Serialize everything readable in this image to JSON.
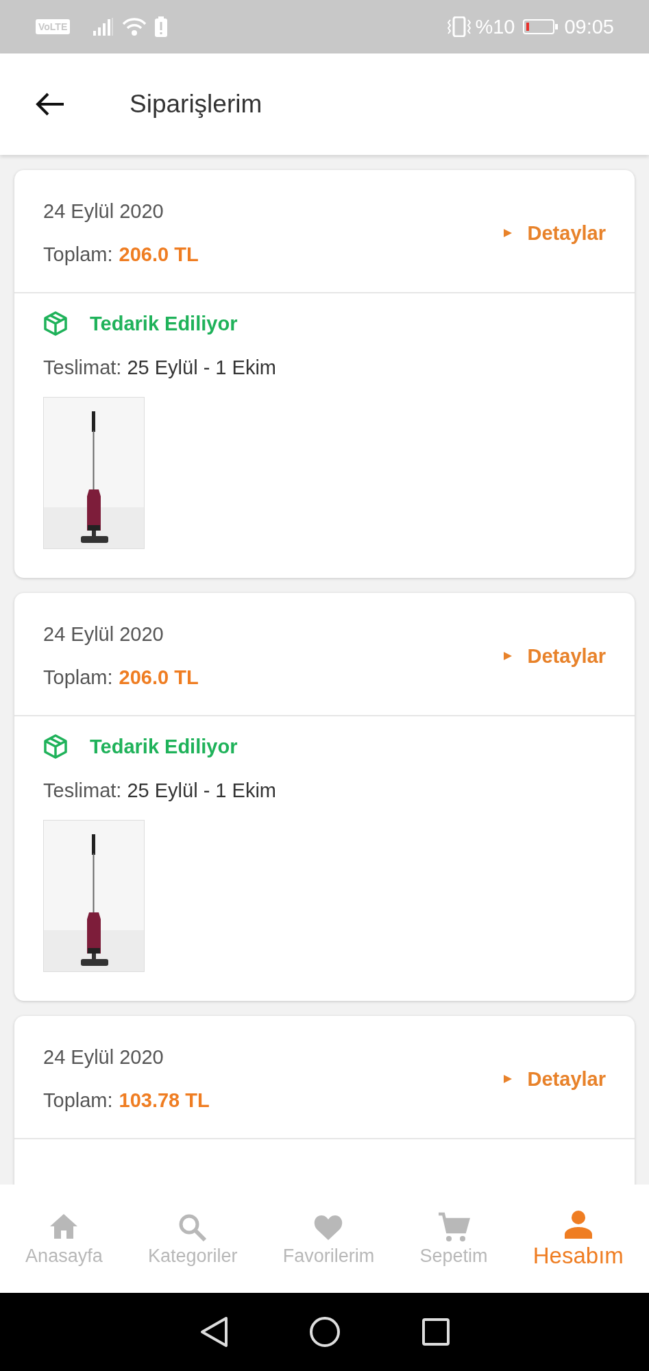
{
  "status_bar": {
    "network_badge": "VoLTE",
    "battery_percent": "%10",
    "time": "09:05"
  },
  "app_bar": {
    "title": "Siparişlerim"
  },
  "orders": [
    {
      "date": "24 Eylül 2020",
      "total_label": "Toplam:",
      "total": "206.0 TL",
      "details_link": "Detaylar",
      "status": "Tedarik Ediliyor",
      "delivery_label": "Teslimat:",
      "delivery": "25 Eylül - 1 Ekim"
    },
    {
      "date": "24 Eylül 2020",
      "total_label": "Toplam:",
      "total": "206.0 TL",
      "details_link": "Detaylar",
      "status": "Tedarik Ediliyor",
      "delivery_label": "Teslimat:",
      "delivery": "25 Eylül - 1 Ekim"
    },
    {
      "date": "24 Eylül 2020",
      "total_label": "Toplam:",
      "total": "103.78 TL",
      "details_link": "Detaylar"
    }
  ],
  "bottom_nav": [
    {
      "label": "Anasayfa",
      "selected": false
    },
    {
      "label": "Kategoriler",
      "selected": false
    },
    {
      "label": "Favorilerim",
      "selected": false
    },
    {
      "label": "Sepetim",
      "selected": false
    },
    {
      "label": "Hesabım",
      "selected": true
    }
  ]
}
